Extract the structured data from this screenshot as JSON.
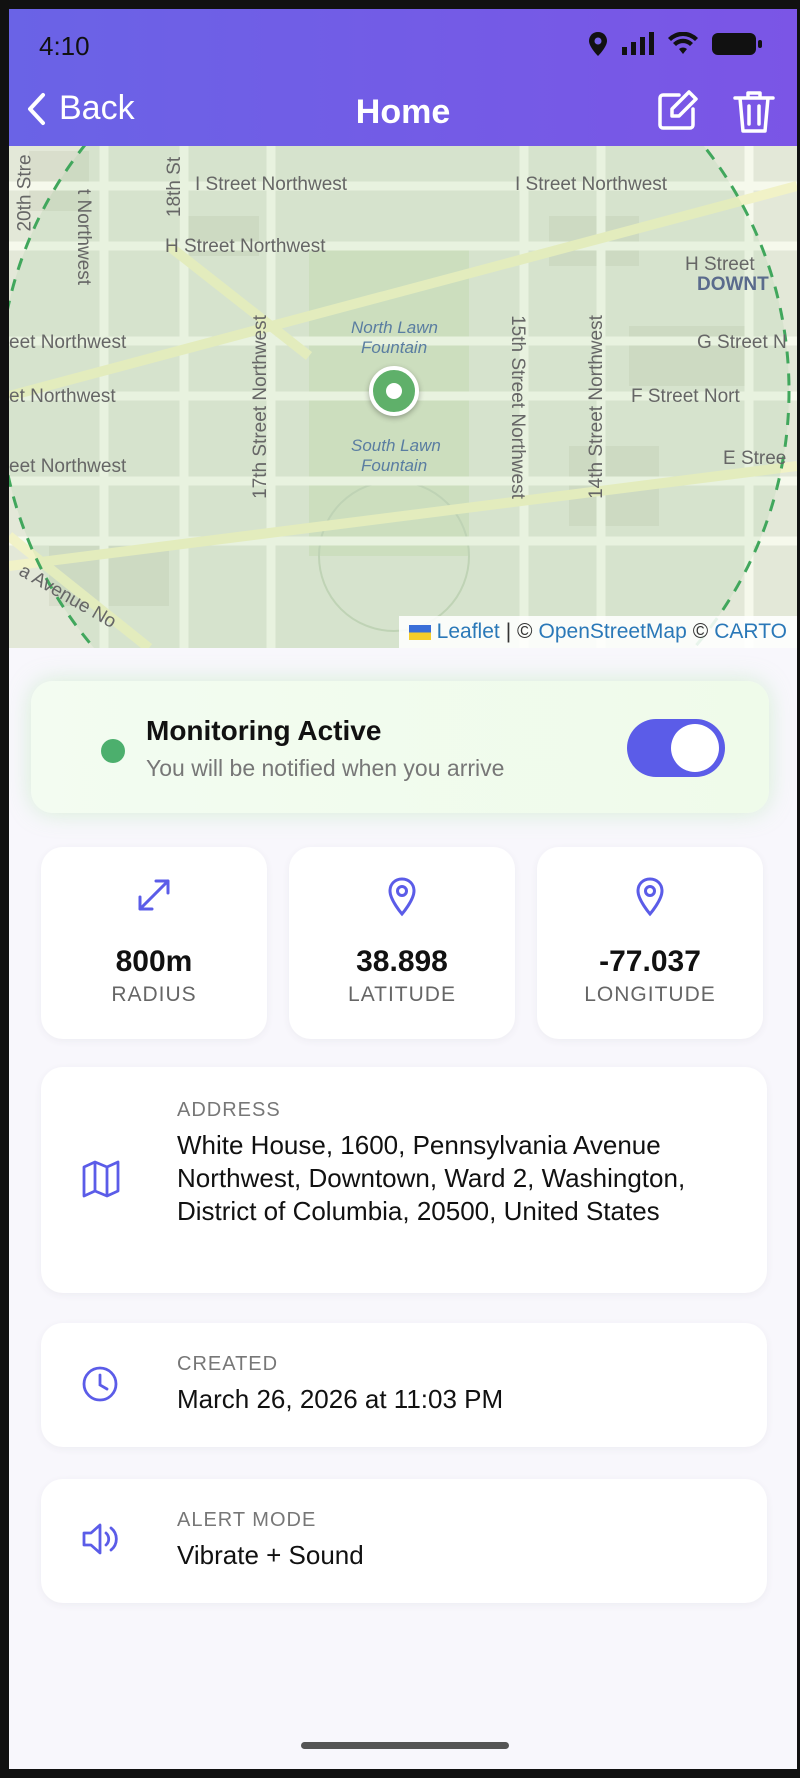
{
  "status_bar": {
    "time": "4:10"
  },
  "header": {
    "back_label": "Back",
    "title": "Home"
  },
  "map": {
    "streets": [
      "I Street Northwest",
      "I Street Northwest",
      "H Street Northwest",
      "H Street",
      "DOWNT",
      "eet Northwest",
      "G Street N",
      "et Northwest",
      "F Street Nort",
      "eet Northwest",
      "E Stree",
      "North Lawn",
      "Fountain",
      "South Lawn",
      "Fountain",
      "17th Street Northwest",
      "15th Street Northwest",
      "14th Street Northwest",
      "18th St",
      "t Northwest",
      "20th Stre",
      "a Avenue No"
    ],
    "attribution": {
      "leaflet": "Leaflet",
      "sep1": "| ©",
      "osm": "OpenStreetMap",
      "sep2": "©",
      "carto": "CARTO"
    }
  },
  "monitoring": {
    "title": "Monitoring Active",
    "subtitle": "You will be notified when you arrive",
    "enabled": true
  },
  "stats": [
    {
      "value": "800m",
      "label": "RADIUS",
      "icon": "expand-arrows-icon"
    },
    {
      "value": "38.898",
      "label": "LATITUDE",
      "icon": "map-pin-icon"
    },
    {
      "value": "-77.037",
      "label": "LONGITUDE",
      "icon": "map-pin-icon"
    }
  ],
  "address": {
    "label": "ADDRESS",
    "value": "White House, 1600, Pennsylvania Avenue Northwest, Downtown, Ward 2, Washington, District of Columbia, 20500, United States"
  },
  "created": {
    "label": "CREATED",
    "value": "March 26, 2026 at 11:03 PM"
  },
  "alert_mode": {
    "label": "ALERT MODE",
    "value": "Vibrate + Sound"
  },
  "colors": {
    "accent": "#5b5ce8",
    "header_start": "#6a63e6",
    "header_end": "#7b55e6",
    "active_green": "#4caf6d"
  }
}
